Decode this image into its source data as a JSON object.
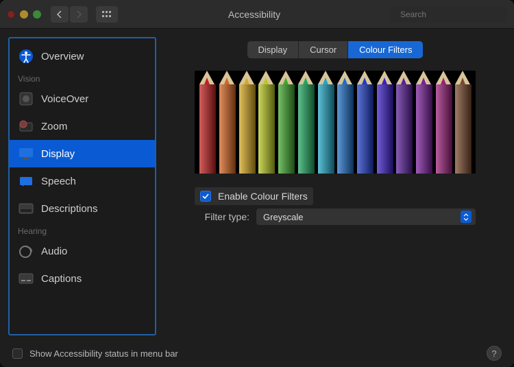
{
  "window": {
    "title": "Accessibility"
  },
  "search": {
    "placeholder": "Search"
  },
  "sidebar": {
    "sections": [
      {
        "label": "",
        "items": [
          {
            "label": "Overview",
            "icon": "accessibility-icon"
          }
        ]
      },
      {
        "label": "Vision",
        "items": [
          {
            "label": "VoiceOver",
            "icon": "voiceover-icon"
          },
          {
            "label": "Zoom",
            "icon": "zoom-icon"
          },
          {
            "label": "Display",
            "icon": "display-icon",
            "selected": true
          },
          {
            "label": "Speech",
            "icon": "speech-icon"
          },
          {
            "label": "Descriptions",
            "icon": "descriptions-icon"
          }
        ]
      },
      {
        "label": "Hearing",
        "items": [
          {
            "label": "Audio",
            "icon": "audio-icon"
          },
          {
            "label": "Captions",
            "icon": "captions-icon"
          }
        ]
      }
    ]
  },
  "tabs": [
    {
      "label": "Display"
    },
    {
      "label": "Cursor"
    },
    {
      "label": "Colour Filters",
      "active": true
    }
  ],
  "pencil_colors": [
    "#c41e1e",
    "#d6641e",
    "#d6a81e",
    "#b8c81e",
    "#3fa82c",
    "#1ea85f",
    "#1ea8c8",
    "#1e6fc8",
    "#1e3dc8",
    "#3b1ec8",
    "#5a1e9c",
    "#7a1e9c",
    "#9c1e7a",
    "#7a4a2c"
  ],
  "controls": {
    "enable_label": "Enable Colour Filters",
    "enable_checked": true,
    "filter_type_label": "Filter type:",
    "filter_type_value": "Greyscale"
  },
  "footer": {
    "statusbar_label": "Show Accessibility status in menu bar",
    "statusbar_checked": false
  }
}
